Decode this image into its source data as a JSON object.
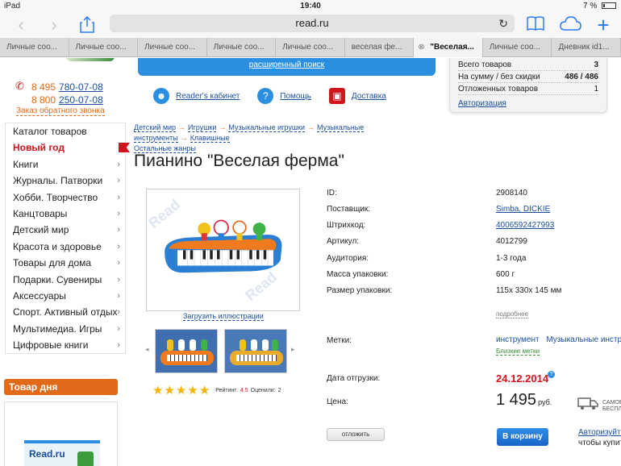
{
  "status_bar": {
    "device": "iPad",
    "time": "19:40",
    "battery": "7 %"
  },
  "toolbar": {
    "url": "read.ru",
    "back_icon": "chevron-left-icon",
    "forward_icon": "chevron-right-icon",
    "share_icon": "share-icon",
    "bookmarks_icon": "book-icon",
    "cloud_icon": "cloud-icon",
    "new_tab_icon": "plus-icon",
    "reload_icon": "reload-icon"
  },
  "tabs": [
    {
      "label": "Личные соо..."
    },
    {
      "label": "Личные соо..."
    },
    {
      "label": "Личные соо..."
    },
    {
      "label": "Личные соо..."
    },
    {
      "label": "Личные соо..."
    },
    {
      "label": "веселая фе..."
    },
    {
      "label": "\"Веселая..."
    },
    {
      "label": "Личные соо..."
    },
    {
      "label": "Дневник id1..."
    }
  ],
  "header": {
    "advanced_search": "расширенный поиск",
    "phone1_code": "8 495",
    "phone1_num": "780-07-08",
    "phone2_code": "8 800",
    "phone2_num": "250-07-08",
    "callback": "Заказ обратного звонка",
    "nav": [
      {
        "label": "Reader's кабинет",
        "icon": "user-icon",
        "color": "#2a8fe0"
      },
      {
        "label": "Помощь",
        "icon": "help-icon",
        "color": "#2a8fe0"
      },
      {
        "label": "Доставка",
        "icon": "truck-icon",
        "color": "#d0151d"
      }
    ]
  },
  "cart": {
    "rows": [
      {
        "label": "Всего товаров",
        "value": "3"
      },
      {
        "label": "На сумму / без скидки",
        "value": "486 / 486"
      },
      {
        "label": "Отложенных товаров",
        "value": "1"
      }
    ],
    "auth_link": "Авторизация"
  },
  "sidebar": {
    "items": [
      {
        "label": "Каталог товаров",
        "chevron": false,
        "red": false
      },
      {
        "label": "Новый год",
        "chevron": false,
        "red": true
      },
      {
        "label": "Книги",
        "chevron": true,
        "red": false
      },
      {
        "label": "Журналы. Патворки",
        "chevron": true,
        "red": false
      },
      {
        "label": "Хобби. Творчество",
        "chevron": true,
        "red": false
      },
      {
        "label": "Канцтовары",
        "chevron": true,
        "red": false
      },
      {
        "label": "Детский мир",
        "chevron": true,
        "red": false
      },
      {
        "label": "Красота и здоровье",
        "chevron": true,
        "red": false
      },
      {
        "label": "Товары для дома",
        "chevron": true,
        "red": false
      },
      {
        "label": "Подарки. Сувениры",
        "chevron": true,
        "red": false
      },
      {
        "label": "Аксессуары",
        "chevron": true,
        "red": false
      },
      {
        "label": "Спорт. Активный отдых",
        "chevron": true,
        "red": false
      },
      {
        "label": "Мультимедиа. Игры",
        "chevron": true,
        "red": false
      },
      {
        "label": "Цифровые книги",
        "chevron": true,
        "red": false
      }
    ],
    "day_title": "Товар дня",
    "day_logo": "Read.ru"
  },
  "breadcrumbs": [
    "Детский мир",
    "Игрушки",
    "Музыкальные игрушки",
    "Музыкальные инструменты",
    "Клавишные"
  ],
  "breadcrumb_extra": "Остальные жанры",
  "product": {
    "title": "Пианино \"Веселая ферма\"",
    "upload_link": "Загрузить иллюстрации",
    "rating_label": "Рейтинг:",
    "rating_value": "4.5",
    "reviews_label": "Оценили:",
    "reviews_value": "2",
    "stars": 5,
    "details": [
      {
        "key": "ID:",
        "value": "2908140",
        "link": false
      },
      {
        "key": "Поставщик:",
        "value": "Simba, DICKIE",
        "link": true
      },
      {
        "key": "Штрихкод:",
        "value": "4006592427993",
        "link": true
      },
      {
        "key": "Артикул:",
        "value": "4012799",
        "link": false
      },
      {
        "key": "Аудитория:",
        "value": "1-3 года",
        "link": false
      },
      {
        "key": "Масса упаковки:",
        "value": "600 г",
        "link": false
      },
      {
        "key": "Размер упаковки:",
        "value": "115х 330х 145 мм",
        "link": false
      }
    ],
    "more": "подробнее",
    "tags_label": "Метки:",
    "tags": [
      "инструмент",
      "Музыкальные инстру"
    ],
    "near_tags": "Близкие метки",
    "ship_label": "Дата отгрузки:",
    "ship_date": "24.12.2014",
    "price_label": "Цена:",
    "price": "1 495",
    "currency": "руб.",
    "free_delivery": "САМОЕ БЕСПЛ",
    "defer_button": "отложить",
    "cart_button": "В корзину",
    "auth_note_link": "Авторизуйте",
    "auth_note_text": "чтобы купит"
  }
}
